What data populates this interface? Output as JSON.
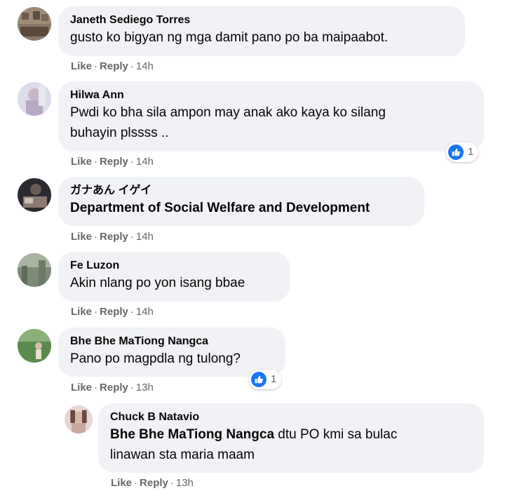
{
  "actions": {
    "like": "Like",
    "separator": "·",
    "reply": "Reply"
  },
  "reaction_icon": "like-icon",
  "accent_color": "#1877f2",
  "comments": [
    {
      "author": "Janeth Sediego Torres",
      "lines": [
        "gusto ko bigyan ng mga damit pano po ba maipaabot."
      ],
      "time": "14h"
    },
    {
      "author": "Hilwa Ann",
      "lines": [
        "Pwdi ko bha sila ampon may anak ako kaya ko silang",
        "buhayin plssss .."
      ],
      "time": "14h",
      "reactions": "1"
    },
    {
      "author": "ガナあん イゲイ",
      "lines": [
        "Department of Social Welfare and Development"
      ],
      "time": "14h"
    },
    {
      "author": "Fe Luzon",
      "lines": [
        "Akin nlang po yon isang bbae"
      ],
      "time": "14h"
    },
    {
      "author": "Bhe Bhe MaTiong Nangca",
      "lines": [
        "Pano po magpdla ng tulong?"
      ],
      "time": "13h",
      "reactions": "1"
    },
    {
      "author": "Chuck B Natavio",
      "mention": "Bhe Bhe MaTiong Nangca",
      "lines": [
        "dtu PO kmi sa bulac",
        "linawan sta maria maam"
      ],
      "time": "13h"
    }
  ]
}
